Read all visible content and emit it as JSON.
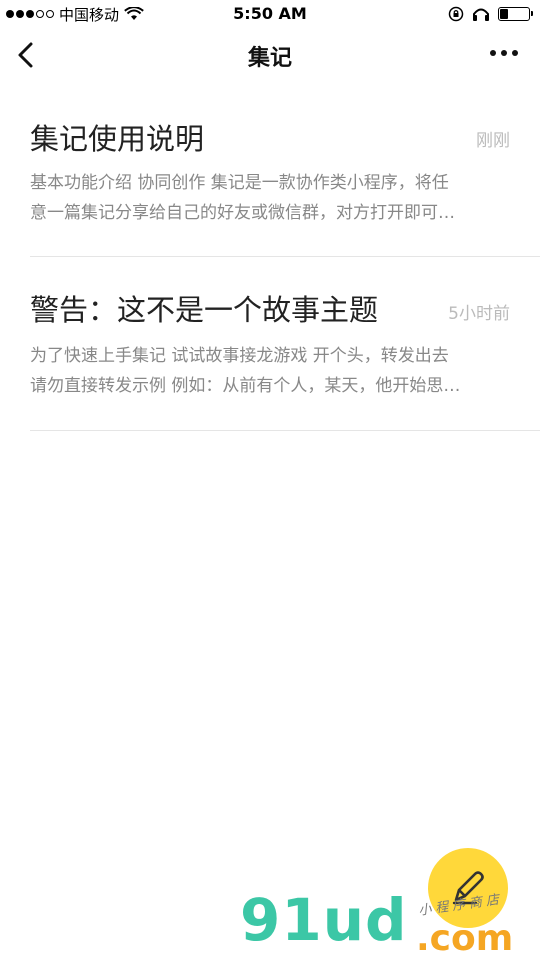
{
  "status_bar": {
    "carrier": "中国移动",
    "time": "5:50 AM",
    "battery_level": 0.3
  },
  "nav": {
    "title": "集记"
  },
  "notes": [
    {
      "title": "集记使用说明",
      "time": "刚刚",
      "excerpt": "基本功能介绍 协同创作 集记是一款协作类小程序，将任\n意一篇集记分享给自己的好友或微信群，对方打开即可…"
    },
    {
      "title": "警告：这不是一个故事主题",
      "time": "5小时前",
      "excerpt": "为了快速上手集记 试试故事接龙游戏 开个头，转发出去\n请勿直接转发示例 例如：从前有个人，某天，他开始思…"
    }
  ],
  "watermark": {
    "brand": "91ud",
    "domain": ".com",
    "tagline": "小程序商店"
  },
  "colors": {
    "watermark_green": "#3cc7a6",
    "watermark_orange": "#f5a623",
    "watermark_yellow": "#ffd83a"
  }
}
